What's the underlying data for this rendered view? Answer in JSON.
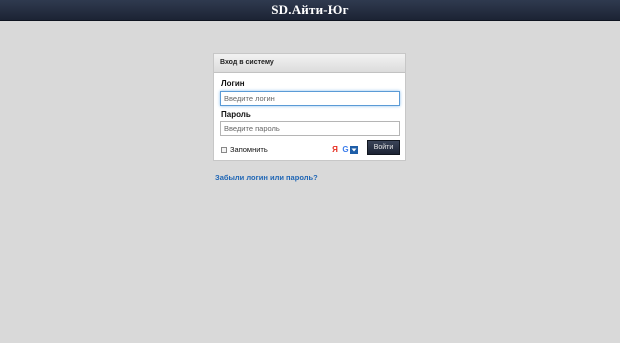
{
  "header": {
    "title": "SD.Айти-Юг"
  },
  "login": {
    "panel_title": "Вход в систему",
    "login_label": "Логин",
    "login_placeholder": "Введите логин",
    "password_label": "Пароль",
    "password_placeholder": "Введите пароль",
    "remember_label": "Запомнить",
    "submit_label": "Войти",
    "social": {
      "yandex": "Я",
      "google": "G"
    }
  },
  "forgot_link": "Забыли логин или пароль?",
  "colors": {
    "topbar": "#1c2334",
    "background": "#d9d9d9",
    "link": "#1f66b5",
    "focus": "#5b9bd6"
  },
  "icons": {
    "yandex": "yandex-icon",
    "google": "google-icon",
    "mail": "mailru-icon"
  }
}
